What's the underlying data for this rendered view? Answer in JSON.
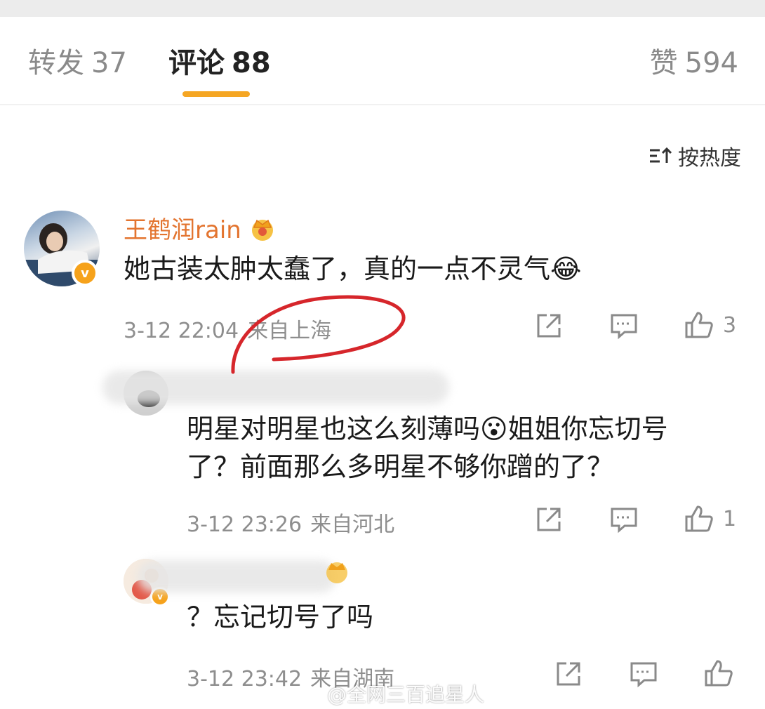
{
  "tabs": {
    "repost": {
      "label": "转发",
      "count": "37"
    },
    "comment": {
      "label": "评论",
      "count": "88"
    },
    "like": {
      "label": "赞",
      "count": "594"
    }
  },
  "sort": {
    "label": "按热度",
    "icon": "sort-icon"
  },
  "comments": [
    {
      "username": "王鹤润rain",
      "badge": "crown-icon",
      "text": "她古装太肿太蠢了，真的一点不灵气😂",
      "time": "3-12 22:04",
      "location": "来自上海",
      "likes": "3"
    },
    {
      "username": "",
      "text_line1": "明星对明星也这么刻薄吗😮姐姐你忘切号",
      "text_line2": "了？前面那么多明星不够你蹭的了？",
      "time": "3-12 23:26",
      "location": "来自河北",
      "likes": "1"
    },
    {
      "username": "",
      "text": "？忘记切号了吗",
      "time": "3-12 23:42",
      "location": "来自湖南",
      "likes": ""
    }
  ],
  "watermark": "@全网三百追星人",
  "colors": {
    "accent": "#f5a623",
    "username": "#e3742f",
    "annotation": "#d6262b"
  }
}
